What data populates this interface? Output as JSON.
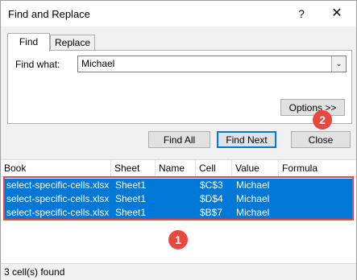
{
  "window": {
    "title": "Find and Replace",
    "help_glyph": "?",
    "close_glyph": "✕"
  },
  "tabs": [
    {
      "label": "Find",
      "active": true
    },
    {
      "label": "Replace",
      "active": false
    }
  ],
  "find": {
    "label": "Find what:",
    "value": "Michael",
    "dropdown_glyph": "⌄"
  },
  "buttons": {
    "options": "Options >>",
    "find_all": "Find All",
    "find_next": "Find Next",
    "close": "Close"
  },
  "results": {
    "columns": [
      "Book",
      "Sheet",
      "Name",
      "Cell",
      "Value",
      "Formula"
    ],
    "rows": [
      [
        "select-specific-cells.xlsx",
        "Sheet1",
        "",
        "$C$3",
        "Michael",
        ""
      ],
      [
        "select-specific-cells.xlsx",
        "Sheet1",
        "",
        "$D$4",
        "Michael",
        ""
      ],
      [
        "select-specific-cells.xlsx",
        "Sheet1",
        "",
        "$B$7",
        "Michael",
        ""
      ]
    ]
  },
  "status": "3 cell(s) found",
  "annotations": {
    "badge_1": "1",
    "badge_2": "2",
    "color": "#e8483f"
  },
  "colors": {
    "selection": "#0078d7",
    "default_button_border": "#0078d7"
  }
}
